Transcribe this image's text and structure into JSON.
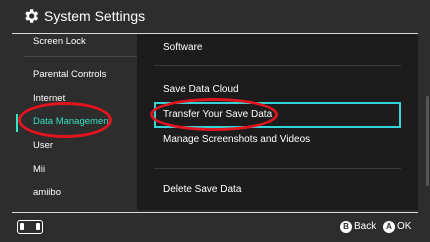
{
  "header": {
    "title": "System Settings",
    "icon": "gear-icon"
  },
  "sidebar": {
    "items": [
      {
        "label": "Screen Lock"
      },
      {
        "label": "Parental Controls"
      },
      {
        "label": "Internet"
      },
      {
        "label": "Data Management",
        "active": true
      },
      {
        "label": "User"
      },
      {
        "label": "Mii"
      },
      {
        "label": "amiibo"
      }
    ]
  },
  "main": {
    "options": [
      {
        "label": "Software"
      },
      {
        "label": "Save Data Cloud"
      },
      {
        "label": "Transfer Your Save Data",
        "selected": true
      },
      {
        "label": "Manage Screenshots and Videos"
      },
      {
        "label": "Delete Save Data"
      }
    ]
  },
  "footer": {
    "controller_icon": "joycon-controller-icon",
    "back": {
      "button": "B",
      "label": "Back"
    },
    "ok": {
      "button": "A",
      "label": "OK"
    }
  },
  "colors": {
    "accent": "#35e2c3",
    "selection_border": "#35d4d9",
    "annotation": "#e3141e",
    "background": "#2d2d2d",
    "panel": "#1c1c1c"
  }
}
